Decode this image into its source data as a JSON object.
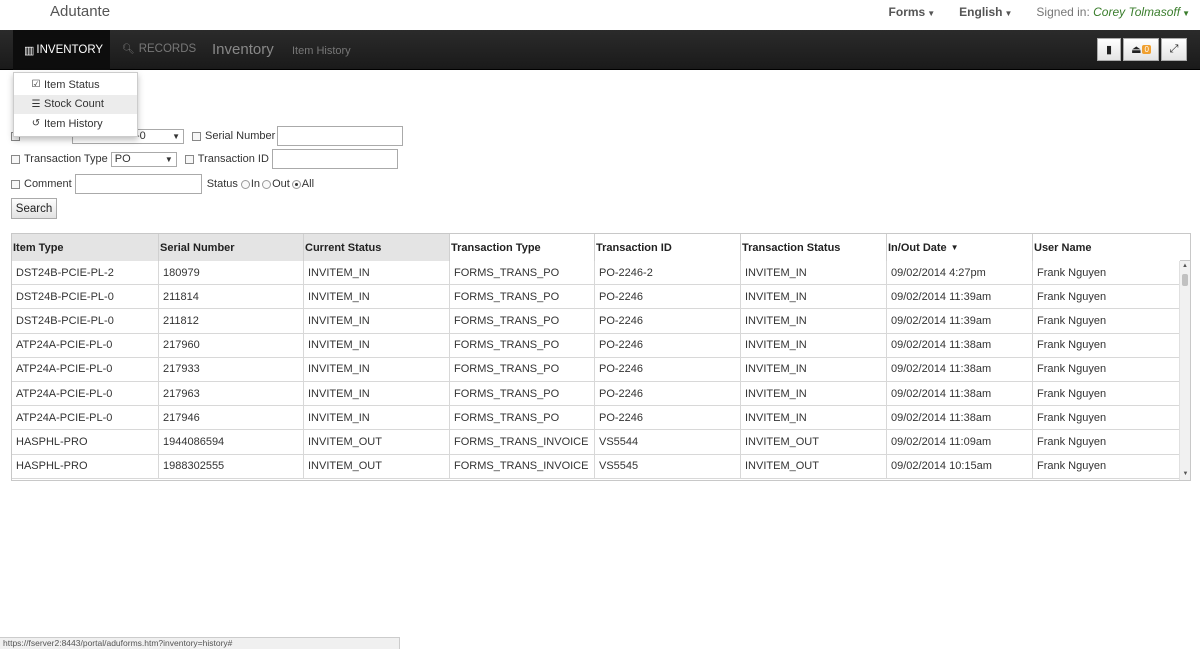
{
  "header": {
    "brand": "Adutante",
    "forms_label": "Forms",
    "language_label": "English",
    "signed_in_prefix": "Signed in:",
    "user_name": "Corey Tolmasoff"
  },
  "navbar": {
    "inventory_label": "INVENTORY",
    "records_label": "RECORDS",
    "title": "Inventory",
    "subtitle": "Item History",
    "notification_count": "0"
  },
  "menu": {
    "items": [
      {
        "label": "Item Status",
        "icon": "checkbox-icon"
      },
      {
        "label": "Stock Count",
        "icon": "list-icon"
      },
      {
        "label": "Item History",
        "icon": "history-icon"
      }
    ]
  },
  "form": {
    "item_type_value": "-0",
    "serial_number_label": "Serial Number",
    "serial_number_value": "",
    "transaction_type_label": "Transaction Type",
    "transaction_type_value": "PO",
    "transaction_id_label": "Transaction ID",
    "transaction_id_value": "",
    "comment_label": "Comment",
    "comment_value": "",
    "status_label": "Status",
    "status_options": [
      "In",
      "Out",
      "All"
    ],
    "status_selected": "All",
    "search_label": "Search"
  },
  "table": {
    "columns": [
      "Item Type",
      "Serial Number",
      "Current Status",
      "Transaction Type",
      "Transaction ID",
      "Transaction Status",
      "In/Out Date",
      "User Name"
    ],
    "rows": [
      [
        "DST24B-PCIE-PL-2",
        "180979",
        "INVITEM_IN",
        "FORMS_TRANS_PO",
        "PO-2246-2",
        "INVITEM_IN",
        "09/02/2014 4:27pm",
        "Frank Nguyen"
      ],
      [
        "DST24B-PCIE-PL-0",
        "211814",
        "INVITEM_IN",
        "FORMS_TRANS_PO",
        "PO-2246",
        "INVITEM_IN",
        "09/02/2014 11:39am",
        "Frank Nguyen"
      ],
      [
        "DST24B-PCIE-PL-0",
        "211812",
        "INVITEM_IN",
        "FORMS_TRANS_PO",
        "PO-2246",
        "INVITEM_IN",
        "09/02/2014 11:39am",
        "Frank Nguyen"
      ],
      [
        "ATP24A-PCIE-PL-0",
        "217960",
        "INVITEM_IN",
        "FORMS_TRANS_PO",
        "PO-2246",
        "INVITEM_IN",
        "09/02/2014 11:38am",
        "Frank Nguyen"
      ],
      [
        "ATP24A-PCIE-PL-0",
        "217933",
        "INVITEM_IN",
        "FORMS_TRANS_PO",
        "PO-2246",
        "INVITEM_IN",
        "09/02/2014 11:38am",
        "Frank Nguyen"
      ],
      [
        "ATP24A-PCIE-PL-0",
        "217963",
        "INVITEM_IN",
        "FORMS_TRANS_PO",
        "PO-2246",
        "INVITEM_IN",
        "09/02/2014 11:38am",
        "Frank Nguyen"
      ],
      [
        "ATP24A-PCIE-PL-0",
        "217946",
        "INVITEM_IN",
        "FORMS_TRANS_PO",
        "PO-2246",
        "INVITEM_IN",
        "09/02/2014 11:38am",
        "Frank Nguyen"
      ],
      [
        "HASPHL-PRO",
        "1944086594",
        "INVITEM_OUT",
        "FORMS_TRANS_INVOICE",
        "VS5544",
        "INVITEM_OUT",
        "09/02/2014 11:09am",
        "Frank Nguyen"
      ],
      [
        "HASPHL-PRO",
        "1988302555",
        "INVITEM_OUT",
        "FORMS_TRANS_INVOICE",
        "VS5545",
        "INVITEM_OUT",
        "09/02/2014 10:15am",
        "Frank Nguyen"
      ]
    ]
  },
  "statusbar": {
    "url": "https://fserver2:8443/portal/aduforms.htm?inventory=history#"
  },
  "colors": {
    "navbar_bg": "#1f1f1f",
    "user_name_color": "#3a7d2c",
    "badge_color": "#f0a030"
  }
}
